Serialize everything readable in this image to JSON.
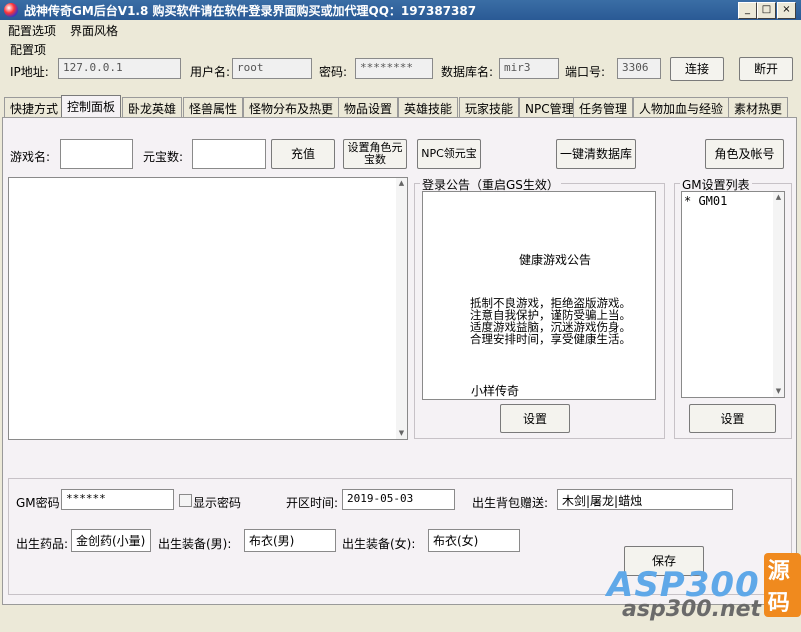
{
  "window": {
    "title": "战神传奇GM后台V1.8   购买软件请在软件登录界面购买或加代理QQ：197387387",
    "minimize": "_",
    "maximize": "□",
    "close": "×"
  },
  "menu": {
    "items": [
      "配置选项",
      "界面风格"
    ]
  },
  "config": {
    "section_title": "配置项",
    "ip_label": "IP地址:",
    "ip_value": "127.0.0.1",
    "user_label": "用户名:",
    "user_value": "root",
    "pwd_label": "密码:",
    "pwd_value": "********",
    "db_label": "数据库名:",
    "db_value": "mir3",
    "port_label": "端口号:",
    "port_value": "3306",
    "connect_button": "连接",
    "disconnect_button": "断开"
  },
  "tabs": [
    "快捷方式",
    "控制面板",
    "卧龙英雄",
    "怪兽属性",
    "怪物分布及热更",
    "物品设置",
    "英雄技能",
    "玩家技能",
    "NPC管理",
    "任务管理",
    "人物加血与经验",
    "素材热更"
  ],
  "active_tab": "控制面板",
  "control": {
    "game_name_label": "游戏名:",
    "game_name_value": "",
    "yuanbao_label": "元宝数:",
    "yuanbao_value": "",
    "recharge_button": "充值",
    "set_role_yuanbao_line1": "设置角色元",
    "set_role_yuanbao_line2": "宝数",
    "npc_yuanbao_button": "NPC领元宝",
    "clear_db_button": "一键清数据库",
    "role_account_button": "角色及帐号",
    "log_text": ""
  },
  "notice": {
    "group_title": "登录公告（重启GS生效）",
    "heading": "健康游戏公告",
    "lines": [
      "抵制不良游戏，拒绝盗版游戏。",
      "注意自我保护，谨防受骗上当。",
      "适度游戏益脑，沉迷游戏伤身。",
      "合理安排时间，享受健康生活。"
    ],
    "footer": "小样传奇",
    "set_button": "设置"
  },
  "gm_list": {
    "group_title": "GM设置列表",
    "items": [
      "* GM01"
    ],
    "set_button": "设置"
  },
  "bottom": {
    "gm_pwd_label": "GM密码:",
    "gm_pwd_value": "******",
    "show_pwd_label": "显示密码",
    "open_time_label": "开区时间:",
    "open_time_value": "2019-05-03",
    "bag_gift_label": "出生背包赠送:",
    "bag_gift_value": "木剑|屠龙|蜡烛",
    "potion_label": "出生药品:",
    "potion_value": "金创药(小量)",
    "equip_male_label": "出生装备(男):",
    "equip_male_value": "布衣(男)",
    "equip_female_label": "出生装备(女):",
    "equip_female_value": "布衣(女)",
    "save_button": "保存"
  },
  "watermark": {
    "brand": "ASP300",
    "tag": "源码",
    "url": "asp300.net"
  },
  "colors": {
    "titlebar": "#2a5a95",
    "window_bg": "#ece9d8",
    "panel_bg": "#f5f2f5",
    "watermark_blue": "#5fa8e8",
    "watermark_orange": "#f08a1e"
  }
}
